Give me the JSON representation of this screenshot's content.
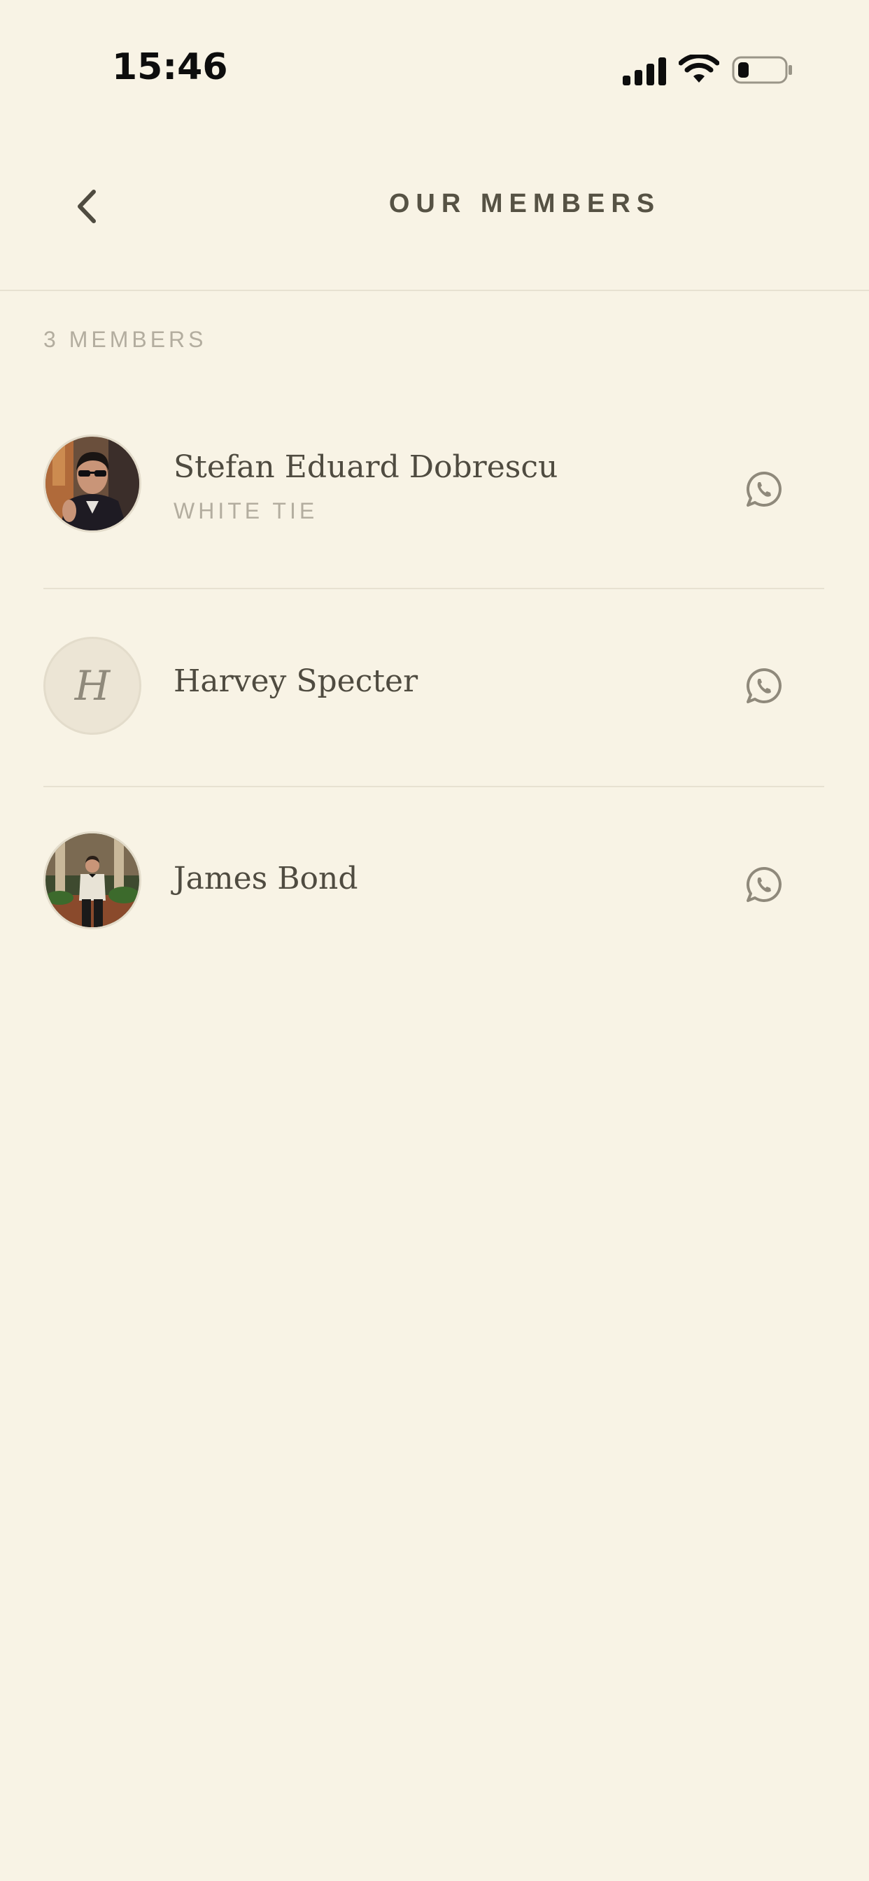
{
  "status_bar": {
    "time": "15:46",
    "icons": [
      "cellular-signal-icon",
      "wifi-icon",
      "battery-icon"
    ]
  },
  "nav": {
    "title": "OUR MEMBERS",
    "back_icon": "chevron-left-icon"
  },
  "members_count_label": "3 MEMBERS",
  "members": [
    {
      "name": "Stefan Eduard Dobrescu",
      "tag": "WHITE TIE",
      "avatar": "photo",
      "action_icon": "whatsapp-icon"
    },
    {
      "name": "Harvey Specter",
      "initial": "H",
      "avatar": "initial",
      "action_icon": "whatsapp-icon"
    },
    {
      "name": "James Bond",
      "avatar": "photo",
      "action_icon": "whatsapp-icon"
    }
  ],
  "colors": {
    "background": "#f8f3e5",
    "text_primary": "#4f4b40",
    "text_muted": "#b3ad9f",
    "divider": "#e7e1d1",
    "icon": "#8f897b"
  }
}
